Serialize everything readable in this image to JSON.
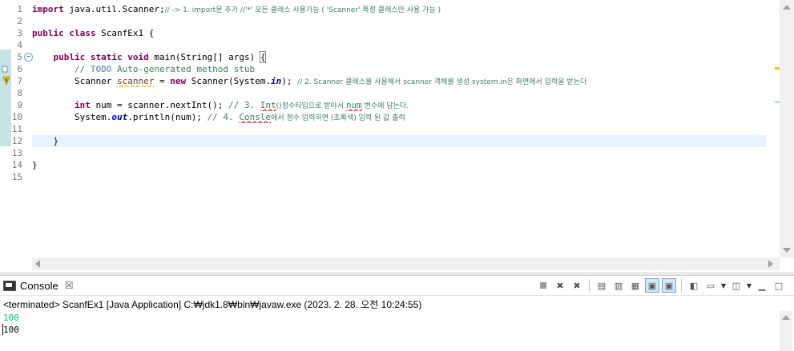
{
  "editor": {
    "line_numbers": [
      "1",
      "2",
      "3",
      "4",
      "5",
      "6",
      "7",
      "8",
      "9",
      "10",
      "11",
      "12",
      "13",
      "14",
      "15"
    ],
    "lines": {
      "l1": {
        "kw_import": "import",
        "pkg": " java.util.Scanner;",
        "comment": "// -> 1. import문 추가 //'*' 모든 클래스 사용가능 ( 'Scanner' 특정 클래스만 사용 가능 )"
      },
      "l3": {
        "kw_public": "public",
        "kw_class": "class",
        "name": " ScanfEx1 {"
      },
      "l5": {
        "kw_public": "public",
        "kw_static": "static",
        "kw_void": "void",
        "sig": " main(String[] args) ",
        "brace": "{"
      },
      "l6": {
        "comment_start": "// ",
        "todo": "TODO",
        "comment_rest": " Auto-generated method stub"
      },
      "l7": {
        "type": "Scanner ",
        "var": "scanner",
        "eq": " = ",
        "kw_new": "new",
        "ctor": " Scanner(System.",
        "field": "in",
        "tail": "); ",
        "comment": "// 2. Scanner 클래스를 사용해서 scanner 객체를 생성 system.in은 화면에서 입력을 받는다"
      },
      "l9": {
        "kw_int": "int",
        "var_decl": " num = scanner.nextInt(); ",
        "comment_a": "// 3. ",
        "comment_spell": "Int",
        "comment_b": "()정수타입으로 받아서 ",
        "comment_spell2": "num",
        "comment_c": " 변수에 담는다."
      },
      "l10": {
        "sys": "System.",
        "field": "out",
        "call": ".println(num); ",
        "comment_a": "// 4. ",
        "comment_spell": "Consle",
        "comment_b": "에서 정수 입력하면 (초록색) 입력 된 값 출력"
      },
      "l12": {
        "text": "    }"
      },
      "l14": {
        "text": "}"
      }
    }
  },
  "console": {
    "tab_label": "Console",
    "tab_close": "☒",
    "status": "<terminated> ScanfEx1 [Java Application] C:₩jdk1.8₩bin₩javaw.exe (2023. 2. 28. 오전 10:24:55)",
    "output_input": "100",
    "output_result": "100"
  },
  "colors": {
    "keyword": "#7f0055",
    "comment": "#3f7f5f",
    "field": "#0000c0",
    "input_echo": "#00c87d",
    "current_line": "#e8f2fe"
  }
}
